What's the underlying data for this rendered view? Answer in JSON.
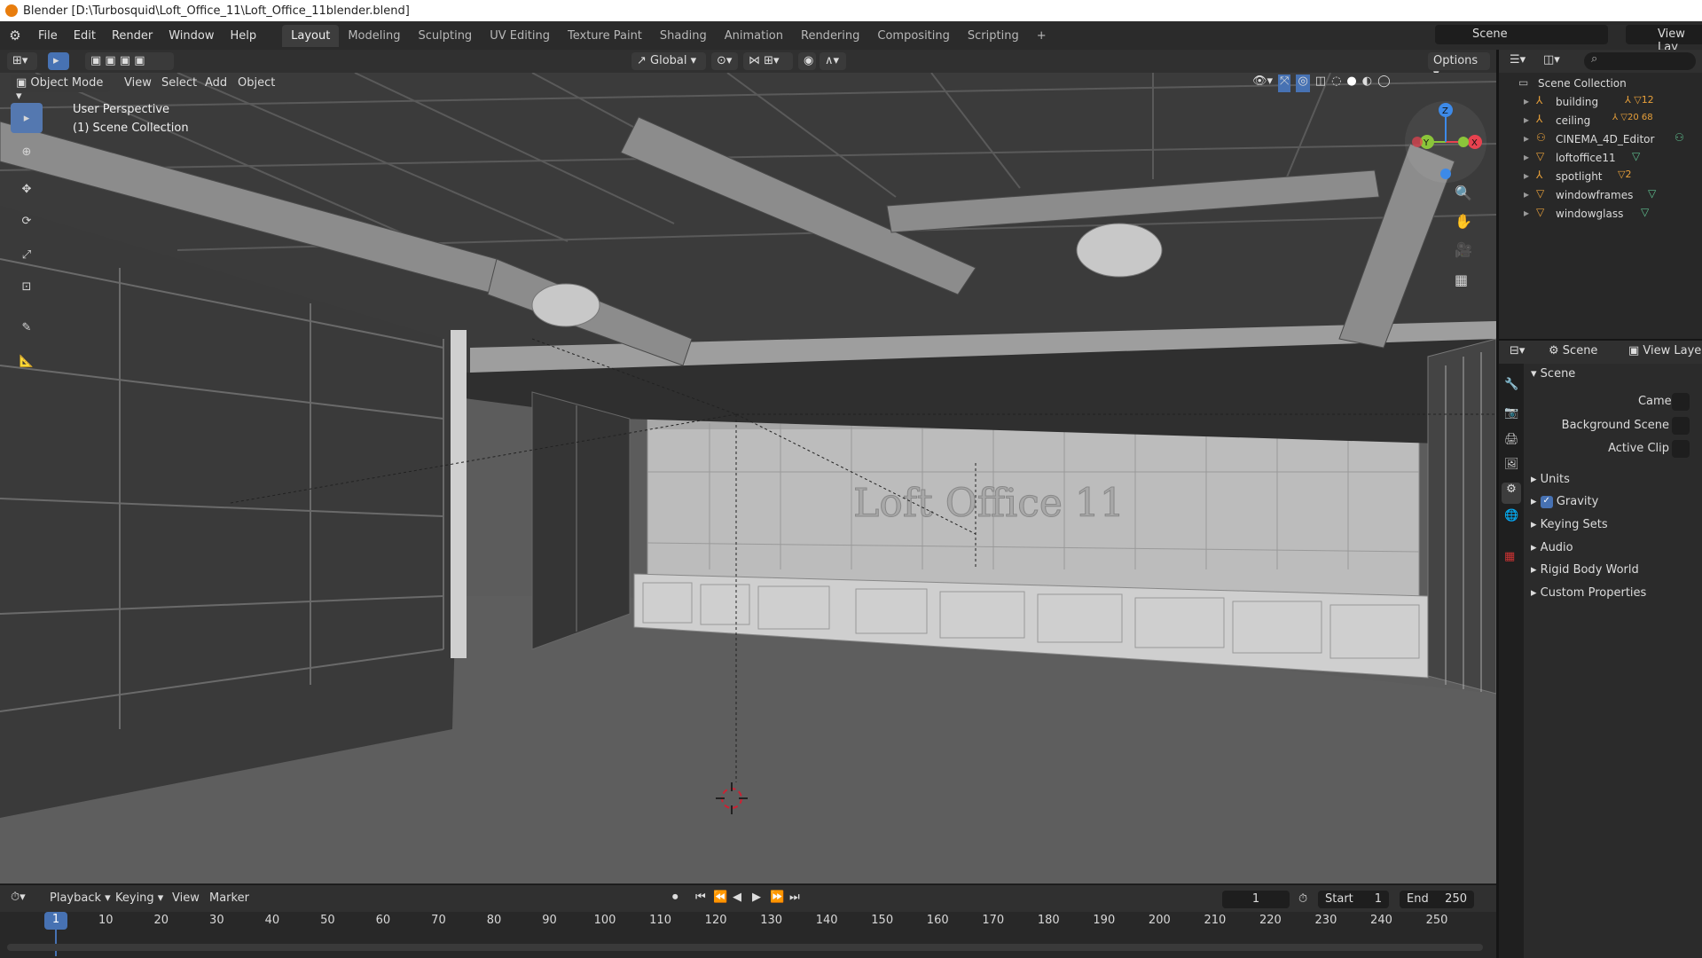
{
  "window": {
    "title": "Blender [D:\\Turbosquid\\Loft_Office_11\\Loft_Office_11blender.blend]"
  },
  "menu": {
    "items": [
      "File",
      "Edit",
      "Render",
      "Window",
      "Help"
    ]
  },
  "workspaces": {
    "tabs": [
      "Layout",
      "Modeling",
      "Sculpting",
      "UV Editing",
      "Texture Paint",
      "Shading",
      "Animation",
      "Rendering",
      "Compositing",
      "Scripting"
    ],
    "active": "Layout",
    "add_label": "+"
  },
  "scene_selector": {
    "label": "Scene"
  },
  "view_layer_selector": {
    "label": "View Lay"
  },
  "viewport_header": {
    "transform_orientation": "Global",
    "options_label": "Options",
    "mode": "Object Mode",
    "menus": [
      "View",
      "Select",
      "Add",
      "Object"
    ]
  },
  "viewport": {
    "info_line1": "User Perspective",
    "info_line2": "(1) Scene Collection",
    "scene_text": "Loft Office 11",
    "gizmo_labels": {
      "x": "X",
      "y": "Y",
      "z": "Z"
    }
  },
  "outliner": {
    "root": "Scene Collection",
    "items": [
      {
        "label": "building",
        "badge": "12"
      },
      {
        "label": "ceiling",
        "badge": "20  68"
      },
      {
        "label": "CINEMA_4D_Editor",
        "badge": ""
      },
      {
        "label": "loftoffice11",
        "badge": ""
      },
      {
        "label": "spotlight",
        "badge": "2"
      },
      {
        "label": "windowframes",
        "badge": ""
      },
      {
        "label": "windowglass",
        "badge": ""
      }
    ]
  },
  "properties": {
    "header_scene": "Scene",
    "header_view_layer": "View Layer",
    "panel_title": "Scene",
    "fields": [
      {
        "label": "Camera"
      },
      {
        "label": "Background Scene"
      },
      {
        "label": "Active Clip"
      }
    ],
    "sections": [
      "Units",
      "Gravity",
      "Keying Sets",
      "Audio",
      "Rigid Body World",
      "Custom Properties"
    ],
    "gravity_checked": true
  },
  "timeline": {
    "menus": [
      "Playback",
      "Keying",
      "View",
      "Marker"
    ],
    "current_frame": "1",
    "start_label": "Start",
    "start_value": "1",
    "end_label": "End",
    "end_value": "250",
    "ticks": [
      "10",
      "20",
      "30",
      "40",
      "50",
      "60",
      "70",
      "80",
      "90",
      "100",
      "110",
      "120",
      "130",
      "140",
      "150",
      "160",
      "170",
      "180",
      "190",
      "200",
      "210",
      "220",
      "230",
      "240",
      "250"
    ],
    "cursor_frame": "1"
  },
  "colors": {
    "accent": "#4772b3",
    "orange": "#e87d0d",
    "gizmo_x": "#e8424f",
    "gizmo_y": "#8bc53a",
    "gizmo_z": "#3d8ae8"
  }
}
